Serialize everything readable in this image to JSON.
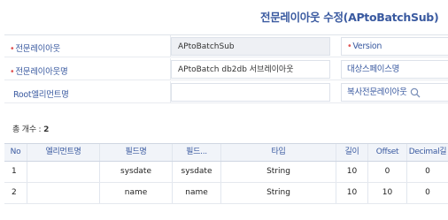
{
  "page": {
    "title": "전문레이아웃 수정(APtoBatchSub)"
  },
  "form": {
    "layout_label": "전문레이아웃",
    "layout_value": "APtoBatchSub",
    "version_label": "Version",
    "layout_name_label": "전문레이아웃명",
    "layout_name_value": "APtoBatch db2db 서브레이아웃",
    "target_space_label": "대상스페이스명",
    "root_element_label": "Root엘리먼트명",
    "root_element_value": "",
    "copy_layout_label": "복사전문레이아웃"
  },
  "summary": {
    "count_label": "총 개수 :",
    "count_value": "2"
  },
  "table": {
    "columns": [
      "No",
      "엘리먼트명",
      "필드명",
      "필드...",
      "타입",
      "길이",
      "Offset",
      "Decimal길"
    ],
    "rows": [
      [
        "1",
        "",
        "sysdate",
        "sysdate",
        "String",
        "10",
        "0",
        "0"
      ],
      [
        "2",
        "",
        "name",
        "name",
        "String",
        "10",
        "10",
        "0"
      ]
    ]
  },
  "colors": {
    "accent": "#3a5aa0",
    "required": "#e05555",
    "header_bg": "#f1f4f9"
  }
}
